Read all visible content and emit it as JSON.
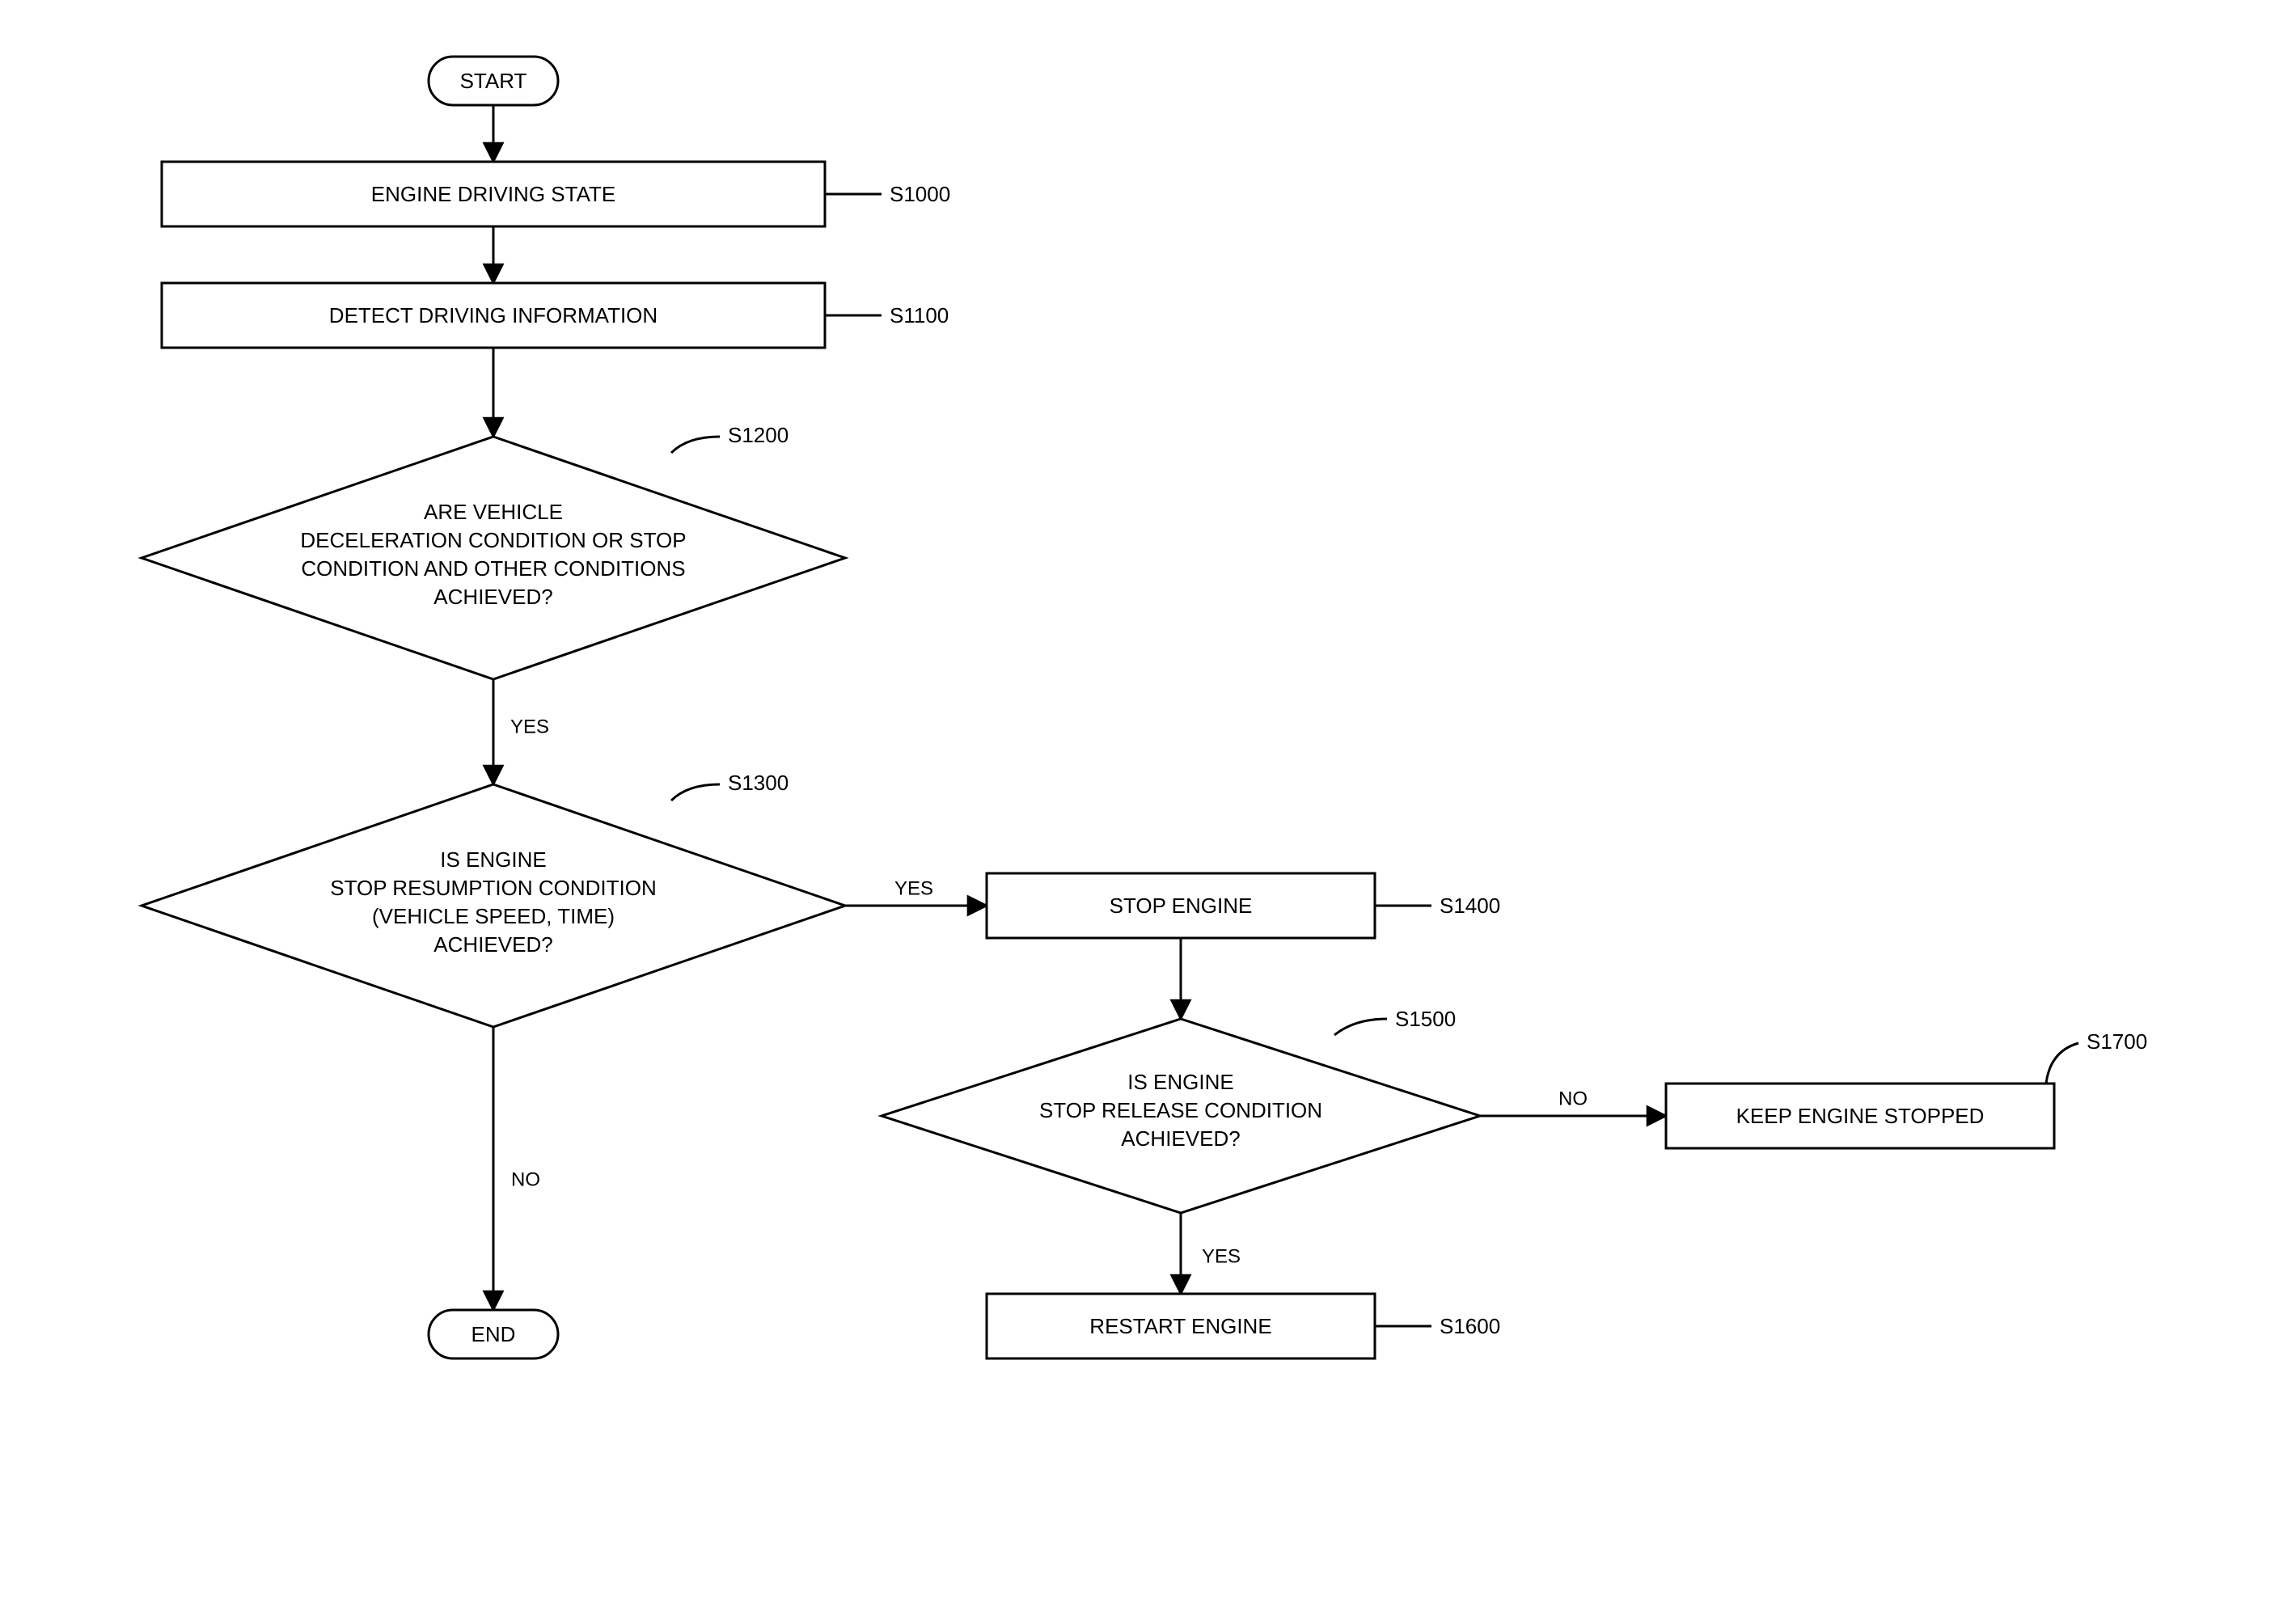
{
  "terminals": {
    "start": "START",
    "end": "END"
  },
  "steps": {
    "s1000": {
      "label": "S1000",
      "text": "ENGINE DRIVING STATE"
    },
    "s1100": {
      "label": "S1100",
      "text": "DETECT DRIVING INFORMATION"
    },
    "s1200": {
      "label": "S1200",
      "l1": "ARE VEHICLE",
      "l2": "DECELERATION CONDITION OR STOP",
      "l3": "CONDITION AND OTHER CONDITIONS",
      "l4": "ACHIEVED?"
    },
    "s1300": {
      "label": "S1300",
      "l1": "IS ENGINE",
      "l2": "STOP RESUMPTION CONDITION",
      "l3": "(VEHICLE SPEED, TIME)",
      "l4": "ACHIEVED?"
    },
    "s1400": {
      "label": "S1400",
      "text": "STOP ENGINE"
    },
    "s1500": {
      "label": "S1500",
      "l1": "IS ENGINE",
      "l2": "STOP RELEASE CONDITION",
      "l3": "ACHIEVED?"
    },
    "s1600": {
      "label": "S1600",
      "text": "RESTART ENGINE"
    },
    "s1700": {
      "label": "S1700",
      "text": "KEEP ENGINE STOPPED"
    }
  },
  "edges": {
    "yes": "YES",
    "no": "NO"
  }
}
